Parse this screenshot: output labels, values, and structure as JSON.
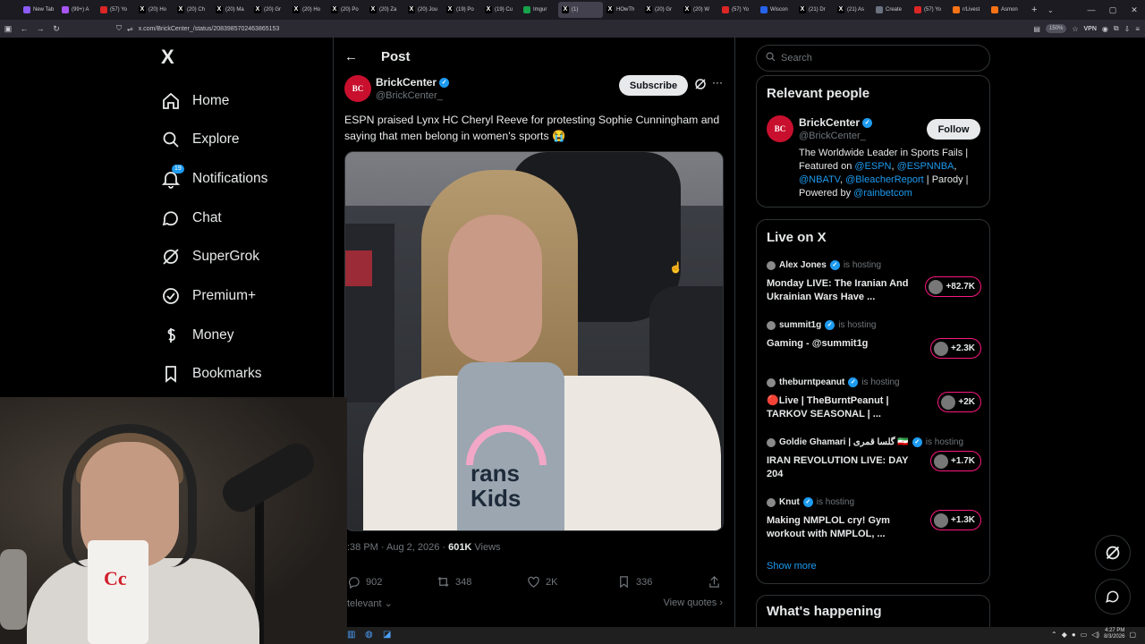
{
  "browser": {
    "tabs": [
      {
        "title": "New Tab",
        "fav": "#8b5cf6",
        "glyph": ""
      },
      {
        "title": "(99+) A",
        "fav": "#a855f7",
        "glyph": ""
      },
      {
        "title": "(57) Yo",
        "fav": "#dc2626",
        "glyph": ""
      },
      {
        "title": "(20) Ho",
        "fav": "#000000",
        "glyph": "X"
      },
      {
        "title": "(20) Ch",
        "fav": "#000000",
        "glyph": "X"
      },
      {
        "title": "(20) Ma",
        "fav": "#000000",
        "glyph": "X"
      },
      {
        "title": "(20) Gr",
        "fav": "#000000",
        "glyph": "X"
      },
      {
        "title": "(20) Ho",
        "fav": "#000000",
        "glyph": "X"
      },
      {
        "title": "(20) Po",
        "fav": "#000000",
        "glyph": "X"
      },
      {
        "title": "(20) Za",
        "fav": "#000000",
        "glyph": "X"
      },
      {
        "title": "(20) Jou",
        "fav": "#000000",
        "glyph": "X"
      },
      {
        "title": "(19) Po",
        "fav": "#000000",
        "glyph": "X"
      },
      {
        "title": "(19) Cu",
        "fav": "#000000",
        "glyph": "X"
      },
      {
        "title": "Imgur",
        "fav": "#16a34a",
        "glyph": ""
      },
      {
        "title": "(1)",
        "fav": "#000000",
        "glyph": "X",
        "active": true
      },
      {
        "title": "HOwTh",
        "fav": "#000000",
        "glyph": "X"
      },
      {
        "title": "(20) Gr",
        "fav": "#000000",
        "glyph": "X"
      },
      {
        "title": "(20) W",
        "fav": "#000000",
        "glyph": "X"
      },
      {
        "title": "(57) Yo",
        "fav": "#dc2626",
        "glyph": ""
      },
      {
        "title": "Wiscon",
        "fav": "#2563eb",
        "glyph": ""
      },
      {
        "title": "(21) Dr",
        "fav": "#000000",
        "glyph": "X"
      },
      {
        "title": "(21) As",
        "fav": "#000000",
        "glyph": "X"
      },
      {
        "title": "Create",
        "fav": "#6b7280",
        "glyph": ""
      },
      {
        "title": "(57) Yo",
        "fav": "#dc2626",
        "glyph": ""
      },
      {
        "title": "r/Livest",
        "fav": "#f97316",
        "glyph": ""
      },
      {
        "title": "Asmon",
        "fav": "#f97316",
        "glyph": ""
      }
    ],
    "url": "x.com/BrickCenter_/status/2083985702463865153",
    "zoom": "150%",
    "vpn_label": "VPN"
  },
  "nav": {
    "logo": "X",
    "items": [
      {
        "label": "Home",
        "icon": "home-icon"
      },
      {
        "label": "Explore",
        "icon": "search-icon"
      },
      {
        "label": "Notifications",
        "icon": "bell-icon",
        "badge": "19"
      },
      {
        "label": "Chat",
        "icon": "chat-icon"
      },
      {
        "label": "SuperGrok",
        "icon": "grok-icon"
      },
      {
        "label": "Premium+",
        "icon": "premium-icon"
      },
      {
        "label": "Money",
        "icon": "money-icon"
      },
      {
        "label": "Bookmarks",
        "icon": "bookmark-icon"
      }
    ]
  },
  "post": {
    "header_title": "Post",
    "author_name": "BrickCenter",
    "author_handle": "@BrickCenter_",
    "avatar_text": "BC",
    "subscribe_label": "Subscribe",
    "text": "ESPN praised Lynx HC Cheryl Reeve for protesting Sophie Cunningham and saying that men belong in women's sports 😭",
    "shirt_text": "rans\nKids",
    "timestamp": ":38 PM · Aug 2, 2026 ·",
    "views": "601K",
    "views_label": "Views",
    "replies": "902",
    "reposts": "348",
    "likes": "2K",
    "bookmarks": "336",
    "relevant_label": "televant",
    "view_quotes": "View quotes"
  },
  "sidebar": {
    "search_placeholder": "Search",
    "relevant_people": {
      "title": "Relevant people",
      "name": "BrickCenter",
      "handle": "@BrickCenter_",
      "avatar_text": "BC",
      "follow_label": "Follow",
      "bio_1": "The Worldwide Leader in Sports Fails | Featured on ",
      "bio_link_1": "@ESPN",
      "bio_2": ", ",
      "bio_link_2": "@ESPNNBA",
      "bio_3": ", ",
      "bio_link_3": "@NBATV",
      "bio_4": ", ",
      "bio_link_4": "@BleacherReport",
      "bio_5": " | Parody | Powered by ",
      "bio_link_5": "@rainbetcom"
    },
    "live": {
      "title": "Live on X",
      "hosting_label": "is hosting",
      "items": [
        {
          "host": "Alex Jones",
          "desc": "Monday LIVE: The Iranian And Ukrainian Wars Have ...",
          "count": "+82.7K"
        },
        {
          "host": "summit1g",
          "desc": "Gaming - @summit1g",
          "count": "+2.3K"
        },
        {
          "host": "theburntpeanut",
          "desc": "🔴Live | TheBurntPeanut | TARKOV SEASONAL | ...",
          "count": "+2K"
        },
        {
          "host": "Goldie Ghamari | گلسا قمری 🇮🇷",
          "desc": "IRAN REVOLUTION LIVE: DAY 204",
          "count": "+1.7K"
        },
        {
          "host": "Knut",
          "desc": "Making NMPLOL cry! Gym workout with NMPLOL, ...",
          "count": "+1.3K"
        }
      ],
      "show_more": "Show more"
    },
    "whats_happening": "What's happening"
  },
  "taskbar": {
    "time": "4:27 PM",
    "date": "8/3/2026"
  },
  "colors": {
    "accent": "#1d9bf0",
    "live_pink": "#f91880",
    "brand_red": "#c8102e"
  }
}
